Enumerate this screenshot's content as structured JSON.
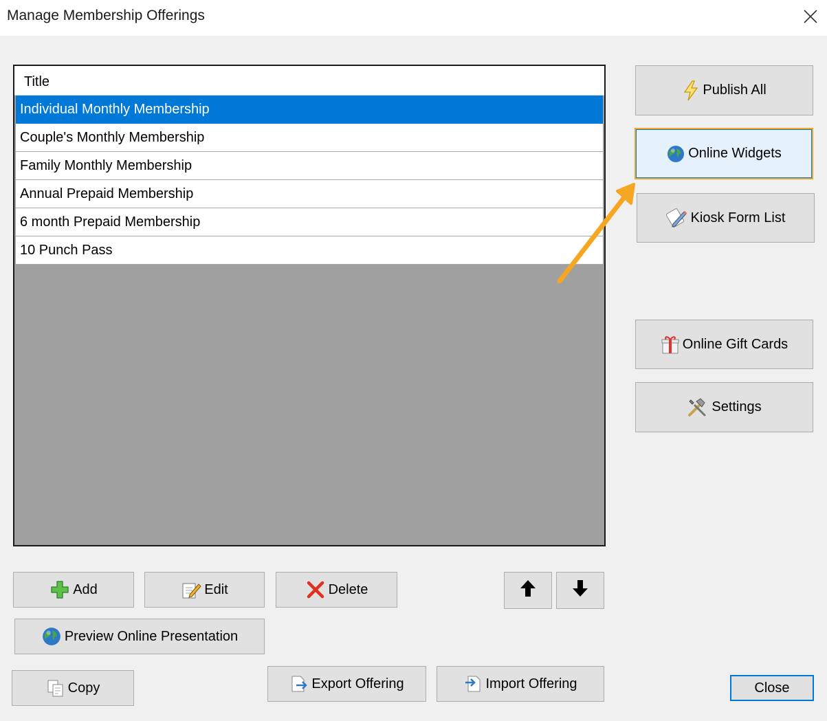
{
  "window": {
    "title": "Manage Membership Offerings",
    "close_icon": "close-icon"
  },
  "list": {
    "header": "Title",
    "items": [
      {
        "label": "Individual Monthly Membership",
        "selected": true
      },
      {
        "label": "Couple's Monthly Membership",
        "selected": false
      },
      {
        "label": "Family Monthly Membership",
        "selected": false
      },
      {
        "label": "Annual Prepaid Membership",
        "selected": false
      },
      {
        "label": "6 month Prepaid Membership",
        "selected": false
      },
      {
        "label": "10 Punch Pass",
        "selected": false
      }
    ]
  },
  "side_buttons": {
    "publish_all": "Publish All",
    "online_widgets": "Online Widgets",
    "kiosk_form_list": "Kiosk Form List",
    "online_gift_cards": "Online Gift Cards",
    "settings": "Settings"
  },
  "bottom_buttons": {
    "add": "Add",
    "edit": "Edit",
    "delete": "Delete",
    "preview": "Preview Online Presentation",
    "copy": "Copy",
    "export": "Export Offering",
    "import": "Import Offering",
    "close": "Close"
  },
  "colors": {
    "selection": "#0078d7",
    "highlight_border": "#f5a623",
    "annotation_arrow": "#f5a623"
  }
}
